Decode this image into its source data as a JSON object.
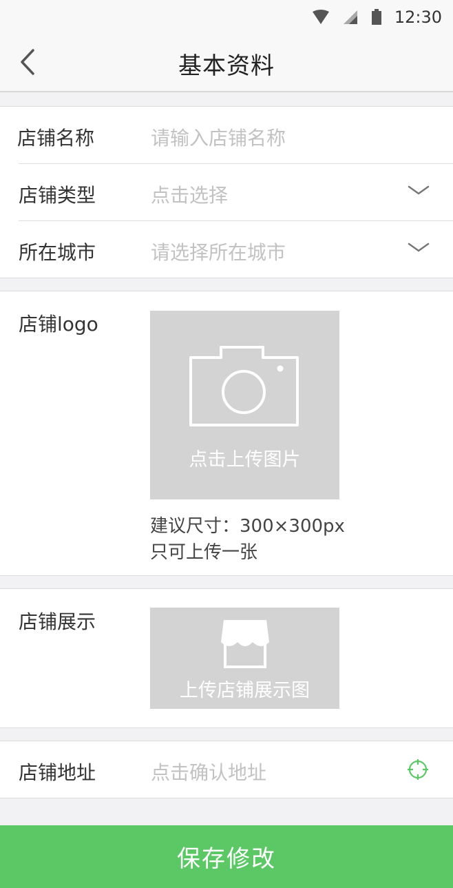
{
  "status_bar": {
    "time": "12:30"
  },
  "header": {
    "title": "基本资料"
  },
  "form": {
    "shop_name": {
      "label": "店铺名称",
      "placeholder": "请输入店铺名称"
    },
    "shop_type": {
      "label": "店铺类型",
      "placeholder": "点击选择"
    },
    "city": {
      "label": "所在城市",
      "placeholder": "请选择所在城市"
    },
    "logo": {
      "label": "店铺logo",
      "upload_text": "点击上传图片",
      "hint_size": "建议尺寸：300×300px",
      "hint_count": "只可上传一张"
    },
    "display": {
      "label": "店铺展示",
      "upload_text": "上传店铺展示图"
    },
    "address": {
      "label": "店铺地址",
      "placeholder": "点击确认地址"
    }
  },
  "actions": {
    "save_label": "保存修改"
  },
  "colors": {
    "accent": "#5bc865",
    "placeholder": "#c2c2c2",
    "upload_bg": "#d3d3d3"
  },
  "icons": [
    "wifi-icon",
    "signal-icon",
    "battery-icon",
    "back-arrow-icon",
    "chevron-down-icon",
    "camera-icon",
    "storefront-icon",
    "locate-icon"
  ]
}
